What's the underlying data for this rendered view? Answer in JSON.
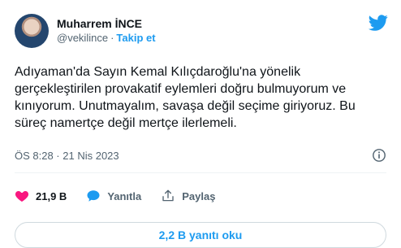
{
  "tweet": {
    "author": {
      "name": "Muharrem İNCE",
      "handle": "@vekilince",
      "separator": "·",
      "follow_label": "Takip et"
    },
    "text": "Adıyaman'da Sayın Kemal Kılıçdaroğlu'na yönelik gerçekleştirilen provakatif eylemleri doğru bulmuyorum ve kınıyorum. Unutmayalım, savaşa değil seçime giriyoruz. Bu süreç namertçe değil mertçe ilerlemeli.",
    "timestamp": "ÖS 8:28 · 21 Nis 2023",
    "actions": {
      "likes": "21,9 B",
      "reply_label": "Yanıtla",
      "share_label": "Paylaş"
    },
    "replies_button": "2,2 B yanıtı oku"
  },
  "colors": {
    "accent": "#1d9bf0",
    "like": "#f91880",
    "muted": "#536471",
    "text": "#0f1419"
  },
  "icons": {
    "brand": "twitter-bird-icon",
    "info": "info-icon",
    "like": "heart-icon",
    "reply": "speech-bubble-icon",
    "share": "share-icon"
  }
}
